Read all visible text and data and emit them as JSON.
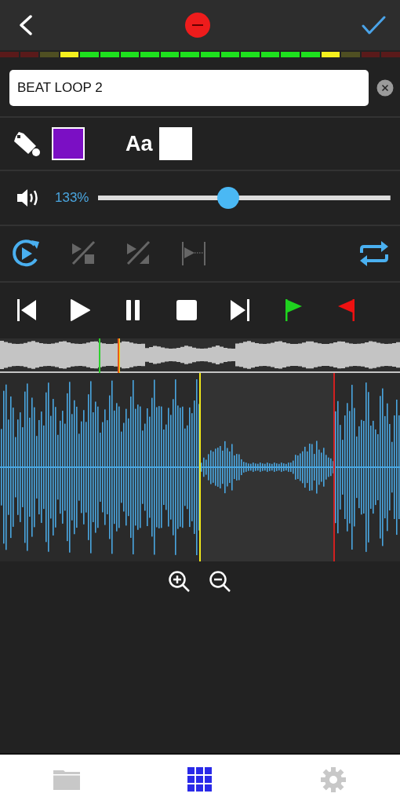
{
  "meter": {
    "segments": [
      {
        "color": "#5a1a1a"
      },
      {
        "color": "#5a1a1a"
      },
      {
        "color": "#4f4f22"
      },
      {
        "color": "#f4f01e"
      },
      {
        "color": "#1ee01e"
      },
      {
        "color": "#1ee01e"
      },
      {
        "color": "#1ee01e"
      },
      {
        "color": "#1ee01e"
      },
      {
        "color": "#1ee01e"
      },
      {
        "color": "#1ee01e"
      },
      {
        "color": "#1ee01e"
      },
      {
        "color": "#1ee01e"
      },
      {
        "color": "#1ee01e"
      },
      {
        "color": "#1ee01e"
      },
      {
        "color": "#1ee01e"
      },
      {
        "color": "#1ee01e"
      },
      {
        "color": "#f4f01e"
      },
      {
        "color": "#4f4f22"
      },
      {
        "color": "#5a1a1a"
      },
      {
        "color": "#5a1a1a"
      }
    ]
  },
  "name_field": {
    "value": "BEAT LOOP 2"
  },
  "style": {
    "fill": {
      "color": "#7b0fc4"
    },
    "text": {
      "label": "Aa",
      "color": "#ffffff"
    }
  },
  "volume": {
    "reading": "133%",
    "level": 0.445
  },
  "tools": [
    {
      "kind": "play-loop",
      "disabled": false
    },
    {
      "kind": "cut-square",
      "disabled": true
    },
    {
      "kind": "cut-triangle",
      "disabled": true
    },
    {
      "kind": "play-to-end",
      "disabled": true
    },
    {
      "kind": "repeat",
      "disabled": false
    }
  ],
  "transport": [
    {
      "kind": "skip-back"
    },
    {
      "kind": "play"
    },
    {
      "kind": "pause"
    },
    {
      "kind": "stop"
    },
    {
      "kind": "skip-forward"
    },
    {
      "kind": "flag-start",
      "color": "#1fd21f"
    },
    {
      "kind": "flag-end",
      "color": "#ee1111"
    }
  ],
  "tabs": [
    {
      "kind": "files",
      "selected": false
    },
    {
      "kind": "pads",
      "selected": true
    },
    {
      "kind": "settings",
      "selected": false
    }
  ]
}
